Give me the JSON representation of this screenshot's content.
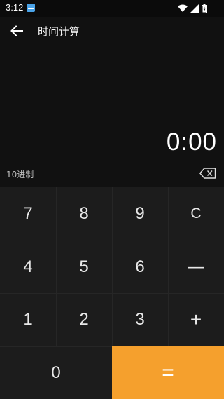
{
  "status_bar": {
    "time": "3:12"
  },
  "header": {
    "title": "时间计算"
  },
  "display": {
    "value": "0:00",
    "mode": "10进制"
  },
  "keypad": {
    "keys": {
      "k7": "7",
      "k8": "8",
      "k9": "9",
      "clear": "C",
      "k4": "4",
      "k5": "5",
      "k6": "6",
      "minus": "—",
      "k1": "1",
      "k2": "2",
      "k3": "3",
      "plus": "+",
      "k0": "0",
      "equals": "="
    }
  },
  "colors": {
    "equals_accent": "#f5a02d",
    "keypad_bg": "#1c1c1c",
    "screen_bg": "#111111"
  }
}
